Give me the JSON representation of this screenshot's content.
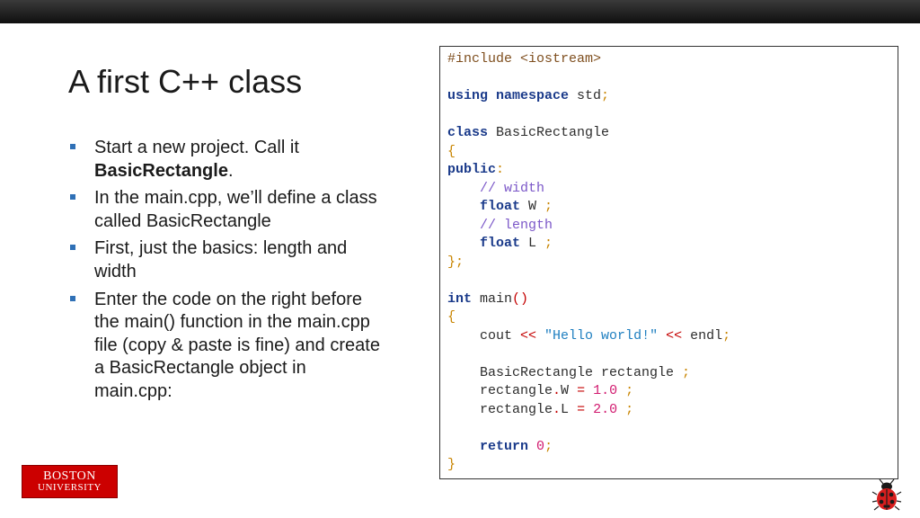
{
  "slide": {
    "title": "A first C++ class",
    "bullets": [
      {
        "pre": "Start a new project. Call it ",
        "bold": "BasicRectangle",
        "post": "."
      },
      {
        "pre": "In the main.cpp, we’ll define a class called BasicRectangle",
        "bold": "",
        "post": ""
      },
      {
        "pre": "First, just the basics: length and width",
        "bold": "",
        "post": ""
      },
      {
        "pre": "Enter the code on the right before the main() function in the main.cpp file (copy & paste is fine) and create a BasicRectangle object in main.cpp:",
        "bold": "",
        "post": ""
      }
    ]
  },
  "code": {
    "lines": [
      [
        {
          "t": "#include <iostream>",
          "c": "pp"
        }
      ],
      [],
      [
        {
          "t": "using namespace",
          "c": "kw"
        },
        {
          "t": " std"
        },
        {
          "t": ";",
          "c": "op"
        }
      ],
      [],
      [
        {
          "t": "class",
          "c": "kw"
        },
        {
          "t": " BasicRectangle"
        }
      ],
      [
        {
          "t": "{",
          "c": "op"
        }
      ],
      [
        {
          "t": "public",
          "c": "kw"
        },
        {
          "t": ":",
          "c": "op"
        }
      ],
      [
        {
          "t": "    "
        },
        {
          "t": "// width",
          "c": "cmt"
        }
      ],
      [
        {
          "t": "    "
        },
        {
          "t": "float",
          "c": "kw"
        },
        {
          "t": " W "
        },
        {
          "t": ";",
          "c": "op"
        }
      ],
      [
        {
          "t": "    "
        },
        {
          "t": "// length",
          "c": "cmt"
        }
      ],
      [
        {
          "t": "    "
        },
        {
          "t": "float",
          "c": "kw"
        },
        {
          "t": " L "
        },
        {
          "t": ";",
          "c": "op"
        }
      ],
      [
        {
          "t": "};",
          "c": "op"
        }
      ],
      [],
      [
        {
          "t": "int",
          "c": "kw"
        },
        {
          "t": " main"
        },
        {
          "t": "()",
          "c": "red"
        }
      ],
      [
        {
          "t": "{",
          "c": "op"
        }
      ],
      [
        {
          "t": "    cout "
        },
        {
          "t": "<<",
          "c": "red"
        },
        {
          "t": " "
        },
        {
          "t": "\"Hello world!\"",
          "c": "str"
        },
        {
          "t": " "
        },
        {
          "t": "<<",
          "c": "red"
        },
        {
          "t": " endl"
        },
        {
          "t": ";",
          "c": "op"
        }
      ],
      [],
      [
        {
          "t": "    BasicRectangle rectangle "
        },
        {
          "t": ";",
          "c": "op"
        }
      ],
      [
        {
          "t": "    rectangle"
        },
        {
          "t": ".",
          "c": "red"
        },
        {
          "t": "W "
        },
        {
          "t": "=",
          "c": "red"
        },
        {
          "t": " "
        },
        {
          "t": "1.0",
          "c": "num"
        },
        {
          "t": " "
        },
        {
          "t": ";",
          "c": "op"
        }
      ],
      [
        {
          "t": "    rectangle"
        },
        {
          "t": ".",
          "c": "red"
        },
        {
          "t": "L "
        },
        {
          "t": "=",
          "c": "red"
        },
        {
          "t": " "
        },
        {
          "t": "2.0",
          "c": "num"
        },
        {
          "t": " "
        },
        {
          "t": ";",
          "c": "op"
        }
      ],
      [],
      [
        {
          "t": "    "
        },
        {
          "t": "return",
          "c": "kw"
        },
        {
          "t": " "
        },
        {
          "t": "0",
          "c": "num"
        },
        {
          "t": ";",
          "c": "op"
        }
      ],
      [
        {
          "t": "}",
          "c": "op"
        }
      ]
    ]
  },
  "logo": {
    "line1": "BOSTON",
    "line2": "UNIVERSITY"
  },
  "colors": {
    "bullet": "#2f70b6",
    "logo_red": "#cc0000",
    "keyword": "#1a3a8a",
    "comment": "#7b57c8",
    "string": "#1f7fc0",
    "number": "#d11a6f"
  },
  "icons": {
    "bottom_right": "ladybug-icon"
  }
}
